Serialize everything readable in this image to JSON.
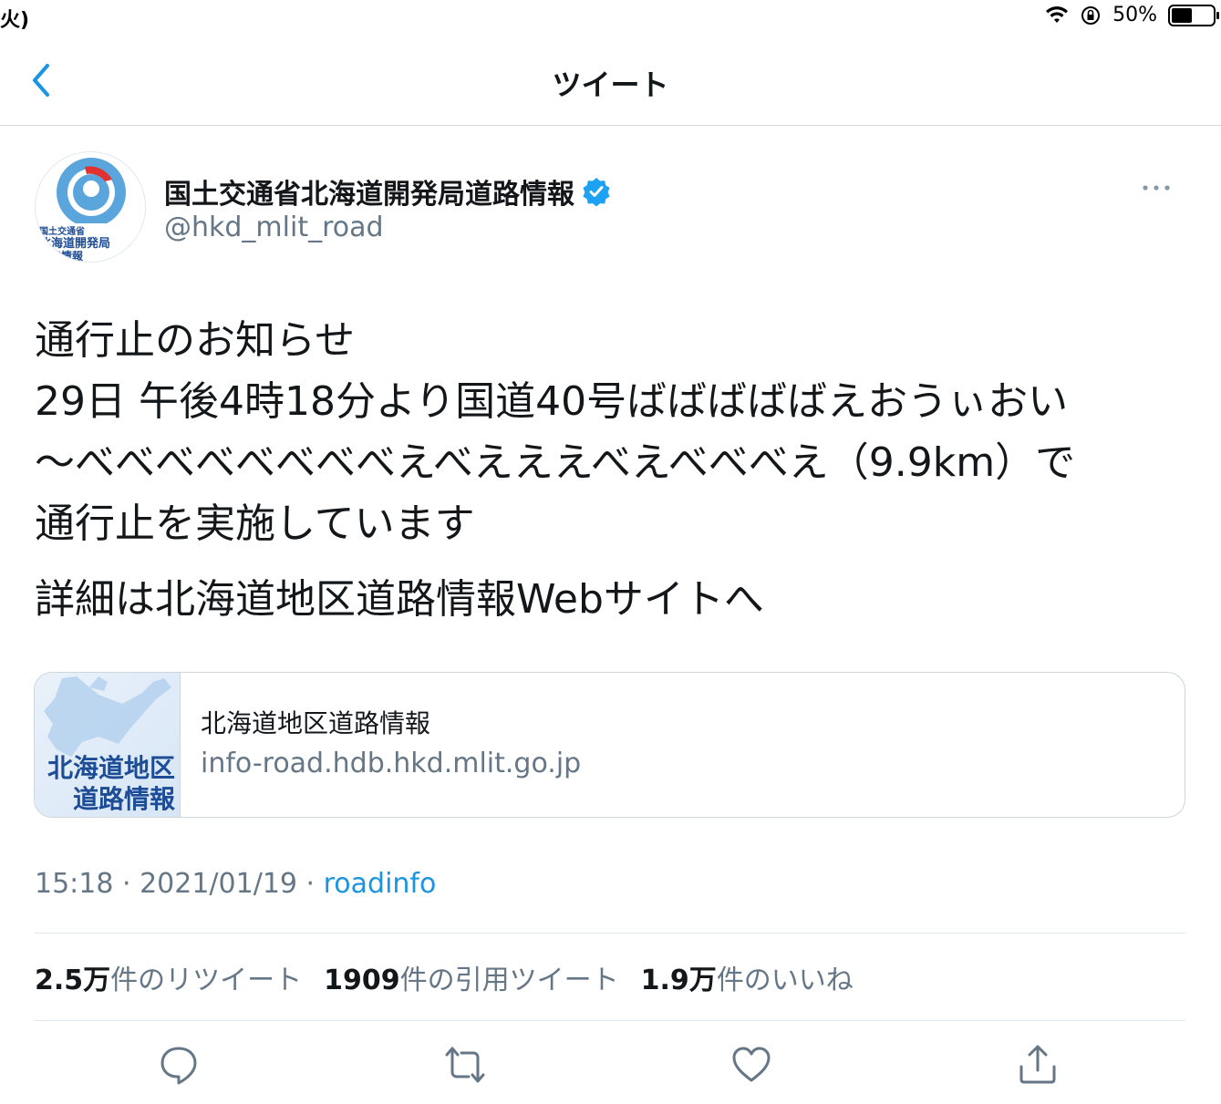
{
  "status_bar": {
    "left_text": "火)",
    "battery_percent": "50%",
    "battery_level": 0.5
  },
  "nav": {
    "title": "ツイート"
  },
  "author": {
    "name": "国土交通省北海道開発局道路情報",
    "handle": "@hkd_mlit_road",
    "avatar_text": [
      "国土交通省",
      "北海道開発局",
      "道路情報"
    ]
  },
  "tweet": {
    "lines": [
      "通行止のお知らせ",
      "29日 午後4時18分より国道40号ばばばばばえおうぃおい",
      "〜べべべべべべべべえべえええべえべべべえ（9.9km）で",
      "通行止を実施しています"
    ],
    "line2": "詳細は北海道地区道路情報Webサイトへ"
  },
  "card": {
    "thumb_text": [
      "北海道地区",
      "道路情報"
    ],
    "title": "北海道地区道路情報",
    "domain": "info-road.hdb.hkd.mlit.go.jp"
  },
  "meta": {
    "time": "15:18",
    "sep1": " · ",
    "date": "2021/01/19",
    "sep2": " · ",
    "source": "roadinfo"
  },
  "stats": {
    "retweets_count": "2.5万",
    "retweets_label": "件のリツイート",
    "quotes_count": "1909",
    "quotes_label": "件の引用ツイート",
    "likes_count": "1.9万",
    "likes_label": "件のいいね"
  },
  "colors": {
    "accent": "#1b95e0",
    "text": "#14171a",
    "secondary": "#657786",
    "border": "#e1e8ed"
  }
}
